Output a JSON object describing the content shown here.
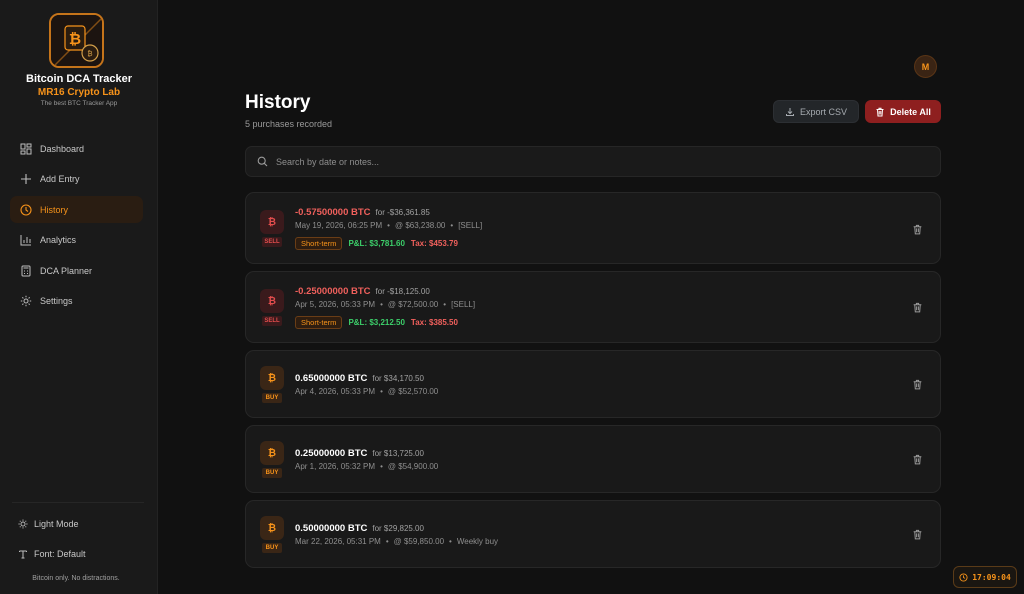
{
  "brand": {
    "title": "Bitcoin DCA Tracker",
    "subtitle": "MR16 Crypto Lab",
    "tagline": "The best BTC Tracker App",
    "logo_icon": "bitcoin-logo-icon"
  },
  "nav": [
    {
      "label": "Dashboard",
      "icon": "grid-icon",
      "active": false
    },
    {
      "label": "Add Entry",
      "icon": "plus-icon",
      "active": false
    },
    {
      "label": "History",
      "icon": "clock-icon",
      "active": true
    },
    {
      "label": "Analytics",
      "icon": "bar-chart-icon",
      "active": false
    },
    {
      "label": "DCA Planner",
      "icon": "calculator-icon",
      "active": false
    },
    {
      "label": "Settings",
      "icon": "gear-icon",
      "active": false
    }
  ],
  "sidebar_footer": {
    "theme_label": "Light Mode",
    "font_label": "Font: Default",
    "tagline": "Bitcoin only. No distractions."
  },
  "user": {
    "avatar_initial": "M"
  },
  "header": {
    "title": "History",
    "subtitle": "5 purchases recorded",
    "export_label": "Export CSV",
    "delete_label": "Delete All"
  },
  "search": {
    "placeholder": "Search by date or notes...",
    "value": ""
  },
  "entries": [
    {
      "type": "SELL",
      "coin": "₿",
      "amount": "-0.57500000 BTC",
      "for": "for -$36,361.85",
      "date": "May 19, 2026, 06:25 PM",
      "price": "@ $63,238.00",
      "note": "[SELL]",
      "term": "Short-term",
      "pnl": "P&L: $3,781.60",
      "tax": "Tax: $453.79"
    },
    {
      "type": "SELL",
      "coin": "₿",
      "amount": "-0.25000000 BTC",
      "for": "for -$18,125.00",
      "date": "Apr 5, 2026, 05:33 PM",
      "price": "@ $72,500.00",
      "note": "[SELL]",
      "term": "Short-term",
      "pnl": "P&L: $3,212.50",
      "tax": "Tax: $385.50"
    },
    {
      "type": "BUY",
      "coin": "₿",
      "amount": "0.65000000 BTC",
      "for": "for $34,170.50",
      "date": "Apr 4, 2026, 05:33 PM",
      "price": "@ $52,570.00",
      "note": ""
    },
    {
      "type": "BUY",
      "coin": "₿",
      "amount": "0.25000000 BTC",
      "for": "for $13,725.00",
      "date": "Apr 1, 2026, 05:32 PM",
      "price": "@ $54,900.00",
      "note": ""
    },
    {
      "type": "BUY",
      "coin": "₿",
      "amount": "0.50000000 BTC",
      "for": "for $29,825.00",
      "date": "Mar 22, 2026, 05:31 PM",
      "price": "@ $59,850.00",
      "note": "Weekly buy"
    }
  ],
  "clock": {
    "time": "17:09:04"
  },
  "colors": {
    "accent": "#f7931a",
    "sell": "#f0605c",
    "profit": "#3ccf6a",
    "danger": "#8e1f1f",
    "background": "#111111"
  }
}
